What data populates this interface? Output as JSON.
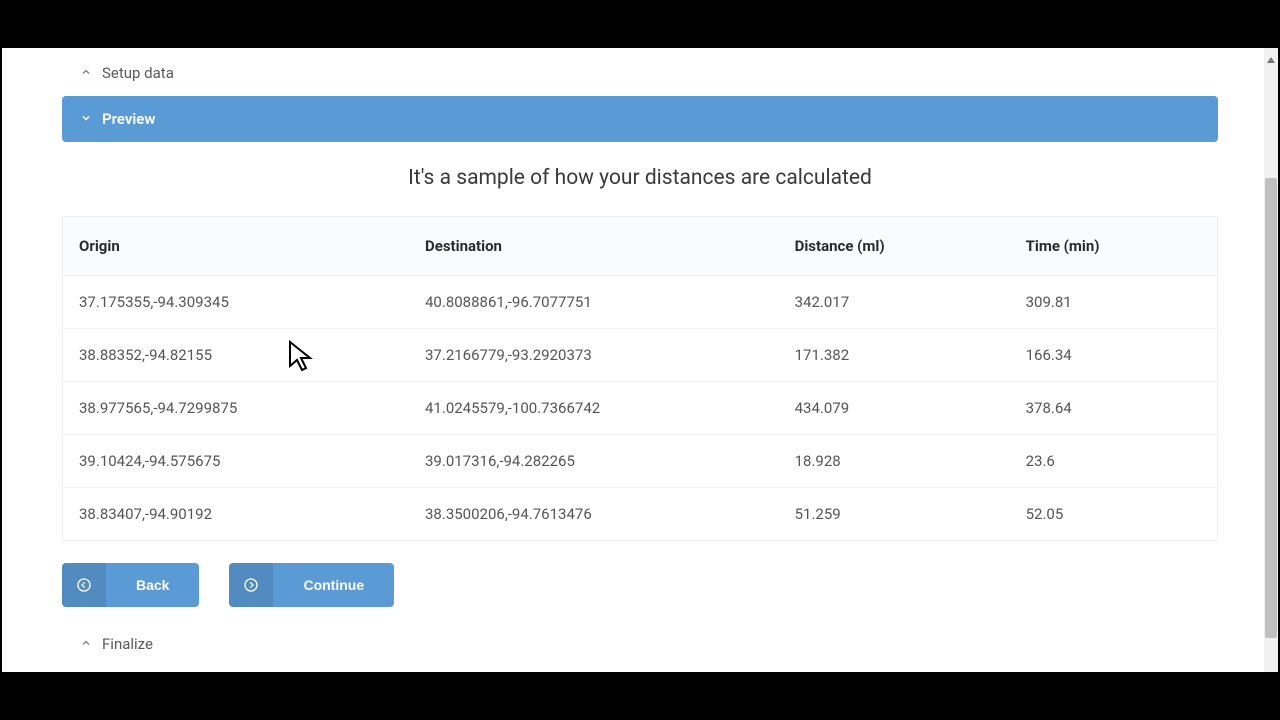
{
  "sections": {
    "setup": "Setup data",
    "preview": "Preview",
    "finalize": "Finalize"
  },
  "sample_text": "It's a sample of how your distances are calculated",
  "table": {
    "headers": {
      "origin": "Origin",
      "destination": "Destination",
      "distance": "Distance (ml)",
      "time": "Time (min)"
    },
    "rows": [
      {
        "origin": "37.175355,-94.309345",
        "destination": "40.8088861,-96.7077751",
        "distance": "342.017",
        "time": "309.81"
      },
      {
        "origin": "38.88352,-94.82155",
        "destination": "37.2166779,-93.2920373",
        "distance": "171.382",
        "time": "166.34"
      },
      {
        "origin": "38.977565,-94.7299875",
        "destination": "41.0245579,-100.7366742",
        "distance": "434.079",
        "time": "378.64"
      },
      {
        "origin": "39.10424,-94.575675",
        "destination": "39.017316,-94.282265",
        "distance": "18.928",
        "time": "23.6"
      },
      {
        "origin": "38.83407,-94.90192",
        "destination": "38.3500206,-94.7613476",
        "distance": "51.259",
        "time": "52.05"
      }
    ]
  },
  "buttons": {
    "back": "Back",
    "continue": "Continue"
  }
}
